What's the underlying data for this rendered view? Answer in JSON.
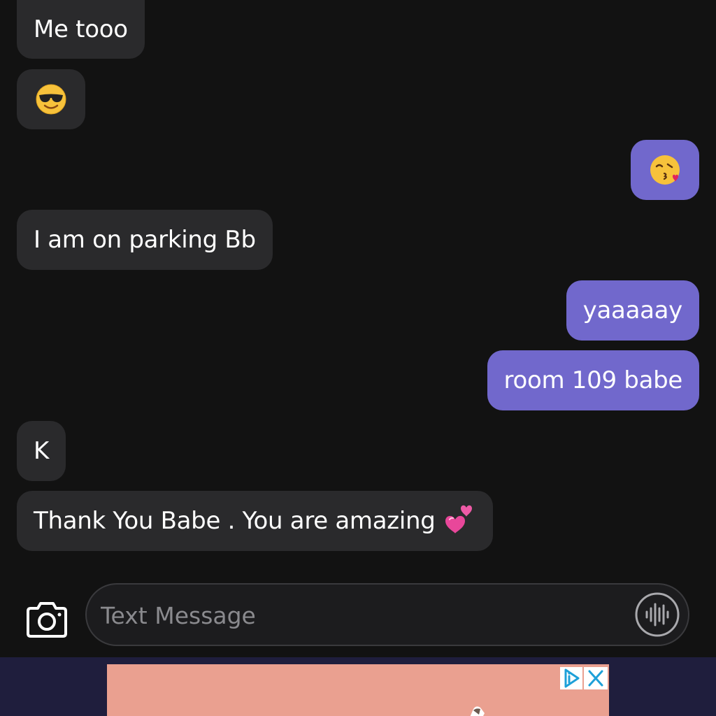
{
  "messages": [
    {
      "direction": "incoming",
      "text": "Me tooo"
    },
    {
      "direction": "incoming",
      "emoji": "smiling-face-with-sunglasses"
    },
    {
      "direction": "outgoing",
      "emoji": "face-blowing-a-kiss"
    },
    {
      "direction": "incoming",
      "text": "I am on parking Bb"
    },
    {
      "direction": "outgoing",
      "text": "yaaaaay"
    },
    {
      "direction": "outgoing",
      "text": "room 109 babe"
    },
    {
      "direction": "incoming",
      "text": "K"
    },
    {
      "direction": "incoming",
      "text": "Thank You  Babe . You are amazing",
      "trailing_emoji": "two-hearts"
    }
  ],
  "composer": {
    "placeholder": "Text Message",
    "value": "",
    "camera_icon": "camera-icon",
    "voice_icon": "voice-waveform-icon"
  },
  "ad_banner": {
    "choices_icon": "ad-choices-icon",
    "close_icon": "close-icon"
  },
  "colors": {
    "background": "#121212",
    "incoming_bubble": "#2a2a2c",
    "outgoing_bubble": "#7168cc",
    "text": "#ffffff",
    "placeholder": "#8a8a8e",
    "ad_bar": "#1f1e3d",
    "ad_creative": "#eaa090"
  }
}
